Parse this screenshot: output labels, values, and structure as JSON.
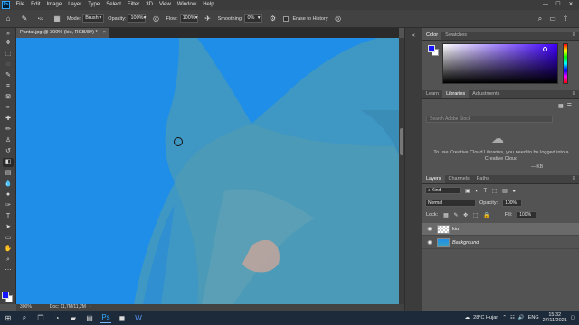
{
  "menubar": {
    "logo": "Ps",
    "items": [
      "File",
      "Edit",
      "Image",
      "Layer",
      "Type",
      "Select",
      "Filter",
      "3D",
      "View",
      "Window",
      "Help"
    ],
    "window_controls": [
      "—",
      "☐",
      "✕"
    ]
  },
  "options": {
    "mode_label": "Mode:",
    "mode_value": "Brush",
    "opacity_label": "Opacity:",
    "opacity_value": "100%",
    "flow_label": "Flow:",
    "flow_value": "100%",
    "smoothing_label": "Smoothing:",
    "smoothing_value": "0%",
    "erase_history_label": "Erase to History",
    "brush_size": "22"
  },
  "document": {
    "tab_title": "Pantai.jpg @ 300% (kiu, RGB/8#) *",
    "zoom": "300%",
    "doc_info": "Doc: 11,7M/11,2M"
  },
  "colors": {
    "foreground": "#1414ff",
    "background": "#ffffff",
    "canvas_blue": "#1f8ee8",
    "accent": "#31a8ff"
  },
  "color_panel": {
    "tabs": [
      "Color",
      "Swatches"
    ]
  },
  "libraries_panel": {
    "tabs": [
      "Learn",
      "Libraries",
      "Adjustments"
    ],
    "search_placeholder": "Search Adobe Stock",
    "message": "To use Creative Cloud Libraries, you need to be logged into a Creative Cloud",
    "footer": "— KB"
  },
  "layers_panel": {
    "tabs": [
      "Layers",
      "Channels",
      "Paths"
    ],
    "kind_label": "Kind",
    "blend_mode": "Normal",
    "opacity_label": "Opacity:",
    "opacity_value": "100%",
    "lock_label": "Lock:",
    "fill_label": "Fill:",
    "fill_value": "100%",
    "layers": [
      {
        "name": "kiu",
        "selected": true
      },
      {
        "name": "Background",
        "selected": false
      }
    ]
  },
  "taskbar": {
    "weather": "28°C  Hujan",
    "lang": "ENG",
    "time": "15:32",
    "date": "27/11/2021"
  }
}
